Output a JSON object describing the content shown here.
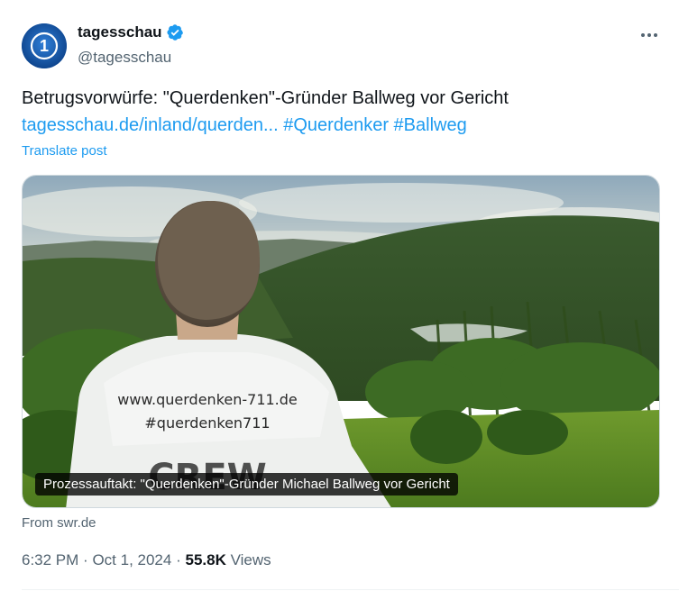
{
  "author": {
    "display_name": "tagesschau",
    "handle": "@tagesschau",
    "verified_icon": "verified-badge-icon",
    "avatar_icon": "tagesschau-logo-icon"
  },
  "tweet": {
    "text": "Betrugsvorwürfe: \"Querdenken\"-Gründer Ballweg vor Gericht",
    "link": "tagesschau.de/inland/querden...",
    "hashtags": [
      "#Querdenker",
      "#Ballweg"
    ],
    "translate_label": "Translate post"
  },
  "media": {
    "caption": "Prozessauftakt: \"Querdenken\"-Gründer Michael Ballweg vor Gericht",
    "shirt_line1": "www.querdenken-711.de",
    "shirt_line2": "#querdenken711",
    "shirt_line3": "CREW",
    "source": "From swr.de"
  },
  "meta": {
    "time": "6:32 PM",
    "separator": "·",
    "date": "Oct 1, 2024",
    "views_count": "55.8K",
    "views_label": "Views"
  },
  "colors": {
    "accent": "#1d9bf0",
    "text": "#0f1419",
    "secondary": "#536471"
  }
}
